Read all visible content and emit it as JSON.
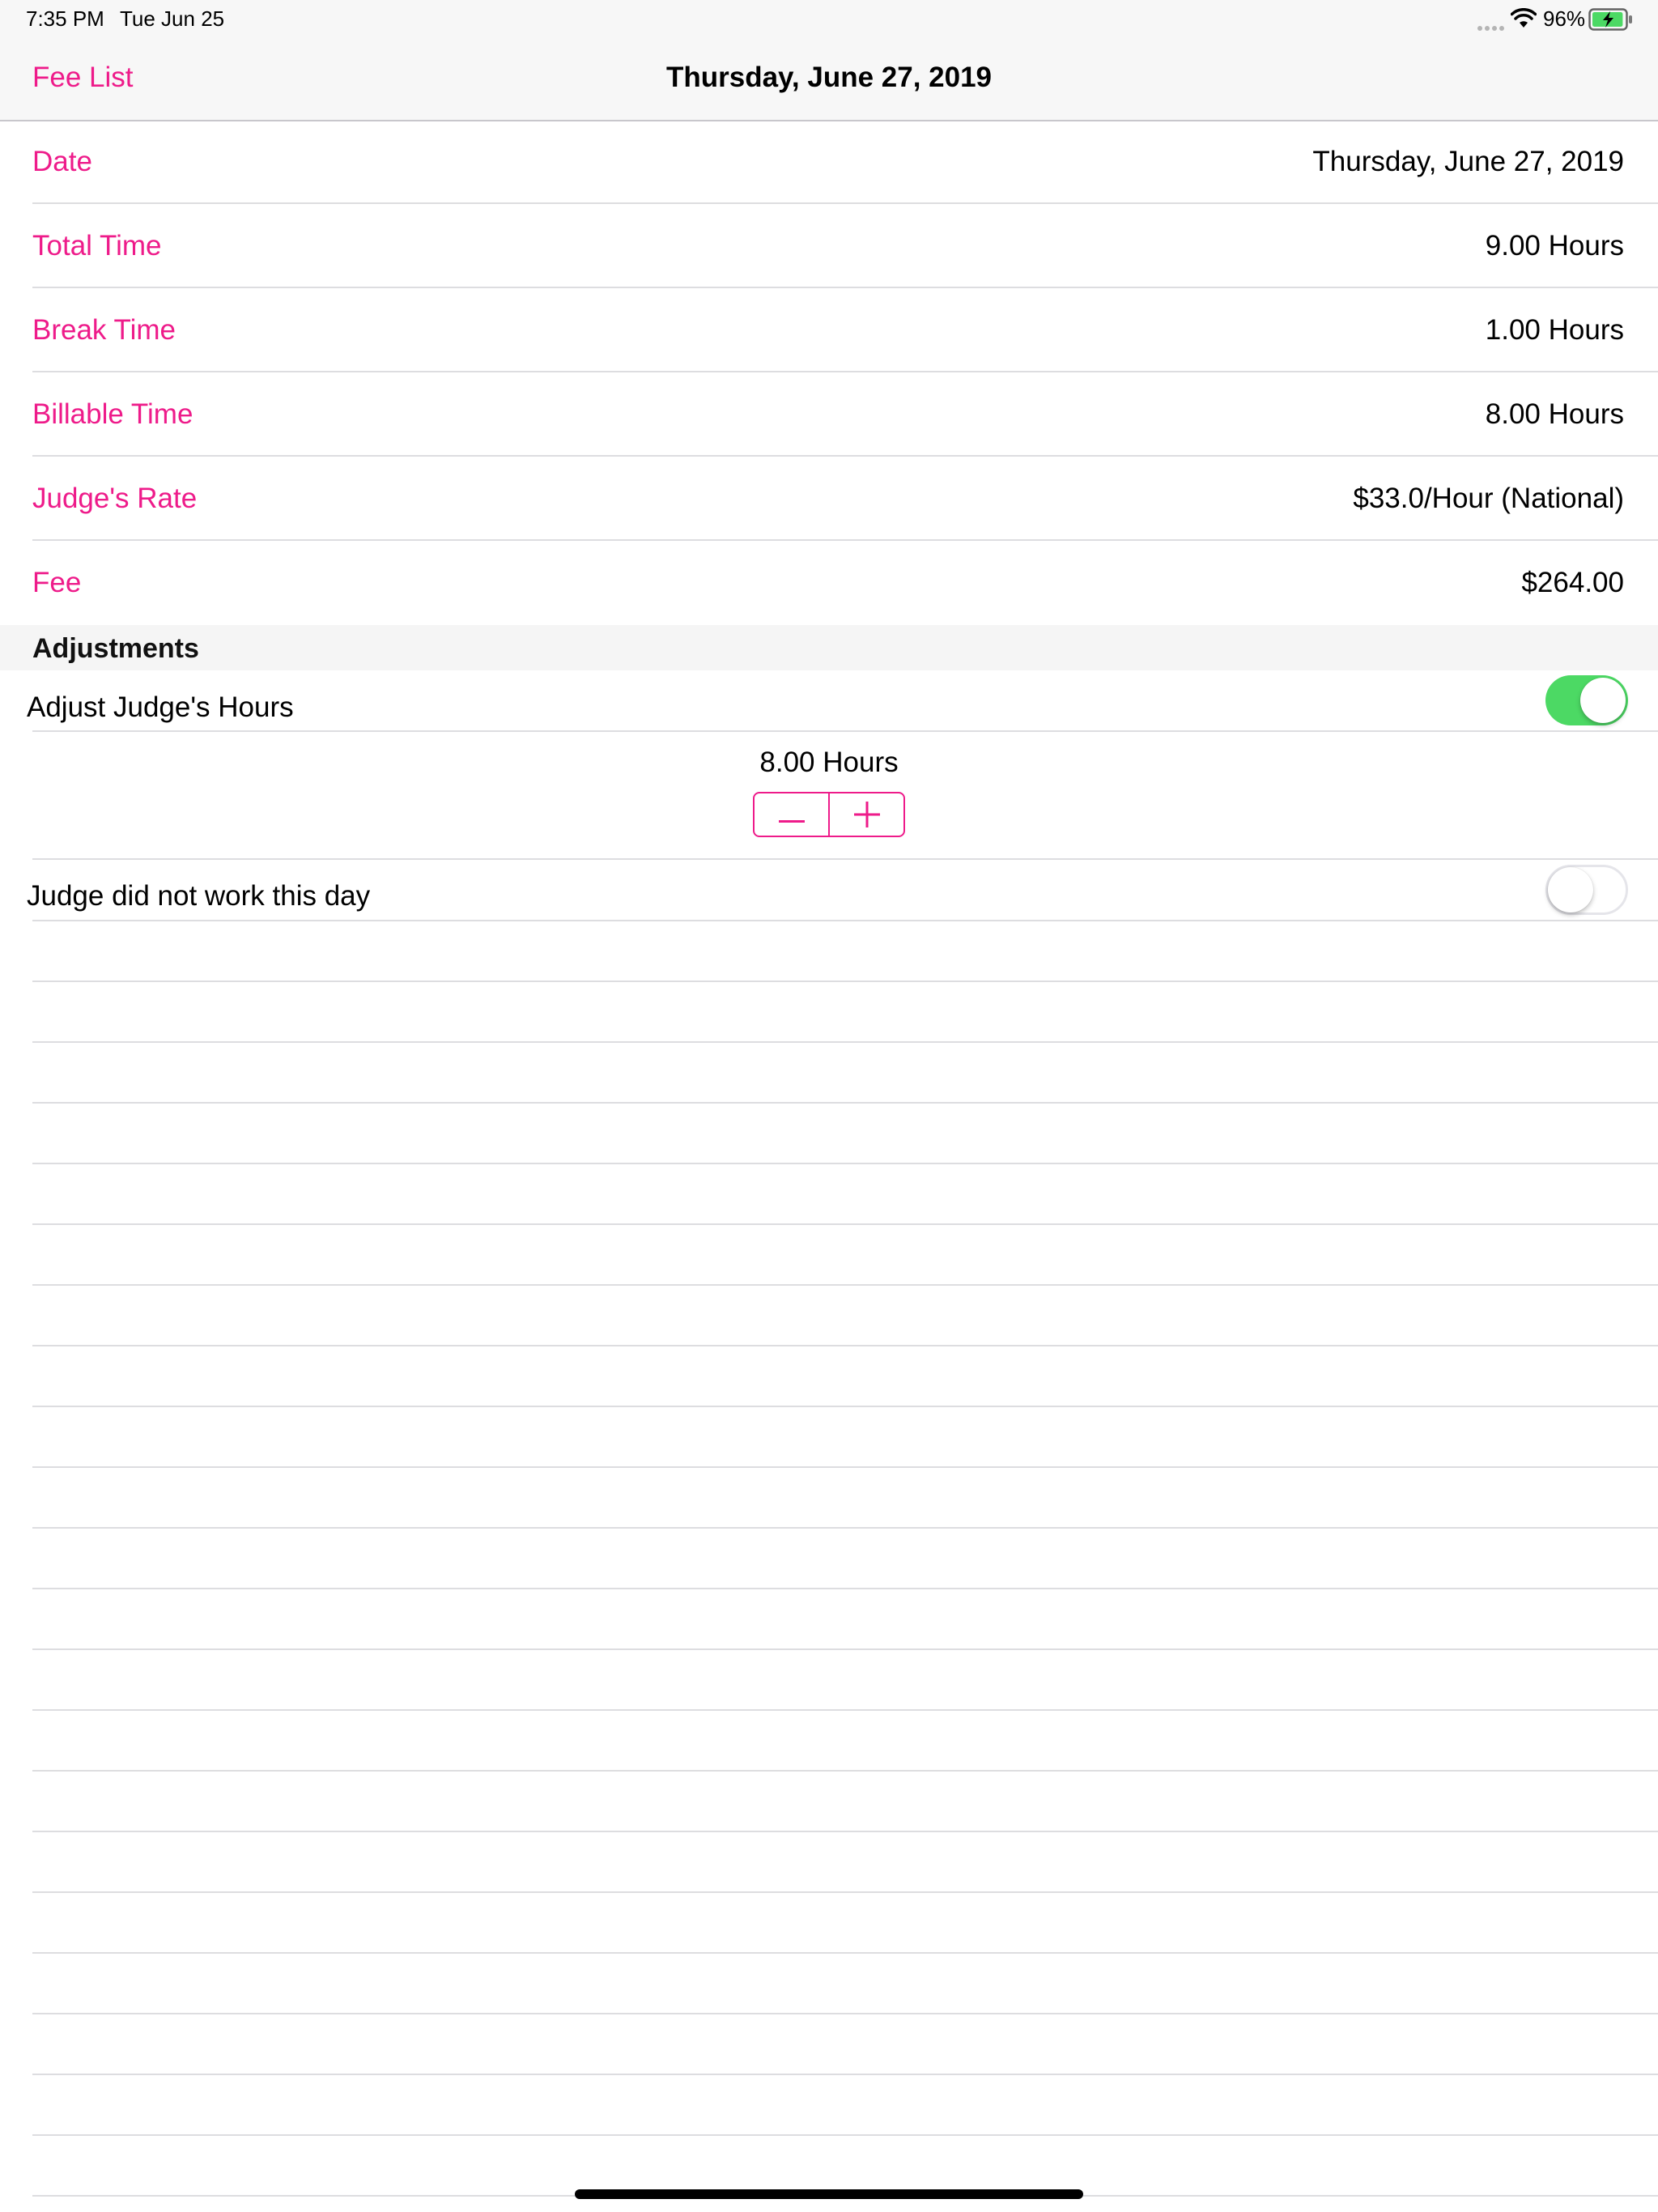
{
  "status_bar": {
    "time": "7:35 PM",
    "date": "Tue Jun 25",
    "battery_percent": "96%",
    "icons": [
      "signal-dots-icon",
      "wifi-icon",
      "battery-charging-icon"
    ],
    "battery_level": 0.96
  },
  "nav": {
    "back_label": "Fee List",
    "title": "Thursday, June 27, 2019"
  },
  "details": [
    {
      "label": "Date",
      "value": "Thursday, June 27, 2019"
    },
    {
      "label": "Total Time",
      "value": "9.00 Hours"
    },
    {
      "label": "Break Time",
      "value": "1.00 Hours"
    },
    {
      "label": "Billable Time",
      "value": "8.00 Hours"
    },
    {
      "label": "Judge's Rate",
      "value": "$33.0/Hour (National)"
    },
    {
      "label": "Fee",
      "value": "$264.00"
    }
  ],
  "adjustments": {
    "header": "Adjustments",
    "adjust_hours": {
      "label": "Adjust Judge's Hours",
      "enabled": true
    },
    "hours_value": "8.00 Hours",
    "stepper": {
      "minus_icon": "minus-icon",
      "plus_icon": "plus-icon"
    },
    "did_not_work": {
      "label": "Judge did not work this day",
      "enabled": false
    }
  },
  "colors": {
    "accent": "#ee1b8a",
    "switch_on": "#4cd964",
    "separator": "#dddde0",
    "bar_background": "#f7f7f7"
  }
}
